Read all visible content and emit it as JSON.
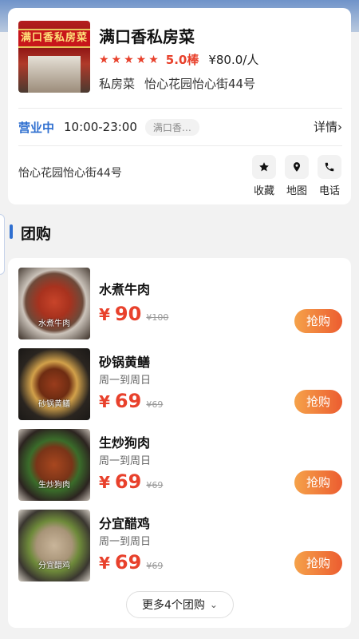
{
  "shop": {
    "name": "满口香私房菜",
    "photo_sign": "满口香私房菜",
    "stars_icon": "★★★★★",
    "score": "5.0棒",
    "price_per_person": "¥80.0/人",
    "category": "私房菜",
    "area": "怡心花园怡心街44号",
    "status": "营业中",
    "hours": "10:00-23:00",
    "hours_tag": "满口香…",
    "details_label": "详情",
    "details_icon": "›",
    "address": "怡心花园怡心街44号",
    "actions": [
      {
        "label": "收藏",
        "icon": "star-icon"
      },
      {
        "label": "地图",
        "icon": "location-pin-icon"
      },
      {
        "label": "电话",
        "icon": "phone-icon"
      }
    ]
  },
  "section": {
    "title": "团购"
  },
  "deals": [
    {
      "name": "水煮牛肉",
      "subtitle": "",
      "currency": "¥",
      "price": "90",
      "original": "¥100",
      "button": "抢购",
      "photo_caption": "水煮牛肉"
    },
    {
      "name": "砂锅黄鳝",
      "subtitle": "周一到周日",
      "currency": "¥",
      "price": "69",
      "original": "¥69",
      "button": "抢购",
      "photo_caption": "砂锅黄鳝"
    },
    {
      "name": "生炒狗肉",
      "subtitle": "周一到周日",
      "currency": "¥",
      "price": "69",
      "original": "¥69",
      "button": "抢购",
      "photo_caption": "生炒狗肉"
    },
    {
      "name": "分宜醋鸡",
      "subtitle": "周一到周日",
      "currency": "¥",
      "price": "69",
      "original": "¥69",
      "button": "抢购",
      "photo_caption": "分宜醋鸡"
    }
  ],
  "more_button": {
    "label": "更多4个团购",
    "icon": "⌄"
  },
  "colors": {
    "accent_blue": "#2f6fd0",
    "price_red": "#e8412c",
    "buy_gradient_start": "#f5a24a",
    "buy_gradient_end": "#ec5d30"
  }
}
